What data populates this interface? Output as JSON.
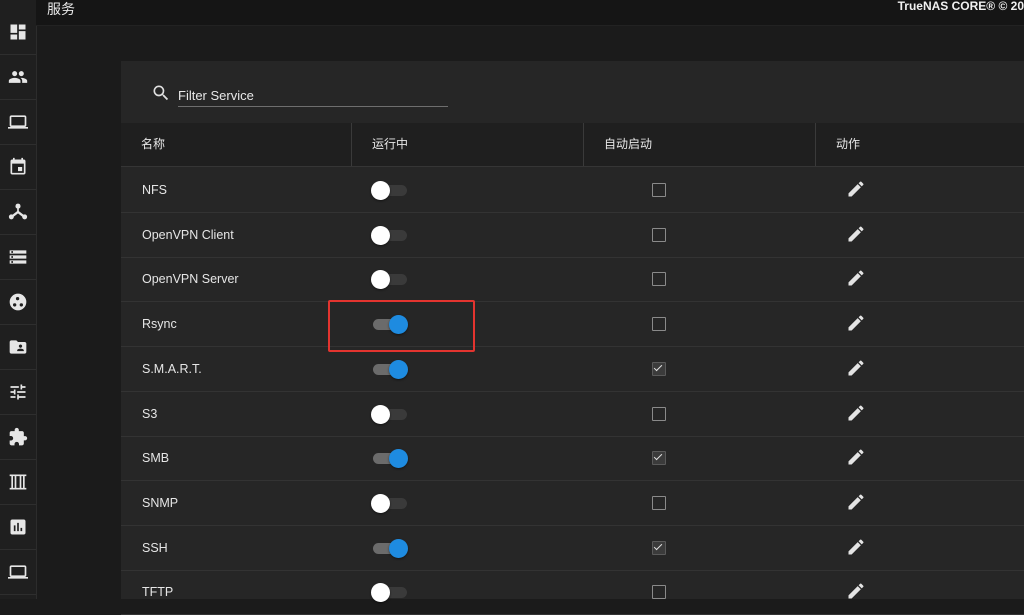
{
  "header": {
    "title": "服务",
    "brand": "TrueNAS CORE® © 20"
  },
  "sidebar": {
    "items": [
      {
        "icon": "dashboard-icon"
      },
      {
        "icon": "accounts-icon"
      },
      {
        "icon": "system-icon"
      },
      {
        "icon": "tasks-calendar-icon"
      },
      {
        "icon": "network-icon"
      },
      {
        "icon": "storage-icon"
      },
      {
        "icon": "directory-services-icon"
      },
      {
        "icon": "sharing-icon"
      },
      {
        "icon": "services-tune-icon"
      },
      {
        "icon": "plugins-puzzle-icon"
      },
      {
        "icon": "jails-icon"
      },
      {
        "icon": "reporting-icon"
      },
      {
        "icon": "virtual-machines-icon"
      }
    ]
  },
  "filter": {
    "placeholder": "Filter Service",
    "value": ""
  },
  "table": {
    "headers": {
      "name": "名称",
      "running": "运行中",
      "autostart": "自动启动",
      "actions": "动作"
    },
    "rows": [
      {
        "name": "NFS",
        "running": false,
        "autostart": false
      },
      {
        "name": "OpenVPN Client",
        "running": false,
        "autostart": false
      },
      {
        "name": "OpenVPN Server",
        "running": false,
        "autostart": false
      },
      {
        "name": "Rsync",
        "running": true,
        "autostart": false
      },
      {
        "name": "S.M.A.R.T.",
        "running": true,
        "autostart": true
      },
      {
        "name": "S3",
        "running": false,
        "autostart": false
      },
      {
        "name": "SMB",
        "running": true,
        "autostart": true
      },
      {
        "name": "SNMP",
        "running": false,
        "autostart": false
      },
      {
        "name": "SSH",
        "running": true,
        "autostart": true
      },
      {
        "name": "TFTP",
        "running": false,
        "autostart": false
      }
    ]
  },
  "colors": {
    "accent": "#1e8be0",
    "highlight": "#e3342f"
  }
}
